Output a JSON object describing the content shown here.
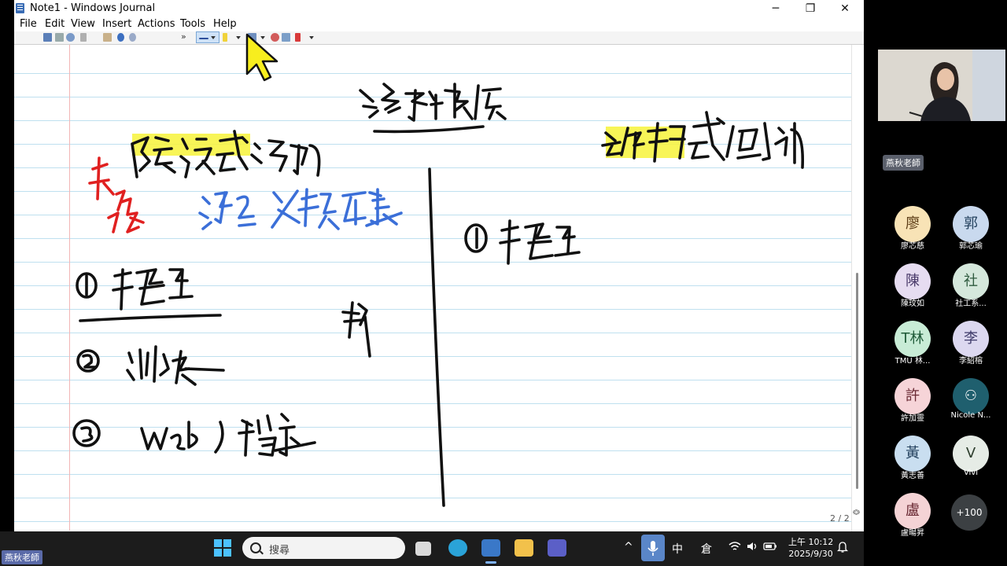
{
  "window": {
    "title": "Note1 - Windows Journal",
    "controls": {
      "minimize": "─",
      "restore": "❐",
      "close": "✕"
    }
  },
  "menu": [
    "File",
    "Edit",
    "View",
    "Insert",
    "Actions",
    "Tools",
    "Help"
  ],
  "toolbar": {
    "overflow": "»"
  },
  "page": {
    "counter": "2 / 2",
    "scroll_up": "︽",
    "scroll_down": "︾"
  },
  "meeting": {
    "presenter_chip": "燕秋老師",
    "more_count": "+100",
    "participants": [
      {
        "initial": "廖",
        "name": "廖芯慈",
        "color": "#f8e3b6"
      },
      {
        "initial": "郭",
        "name": "郭芯瑜",
        "color": "#c9d9ee"
      },
      {
        "initial": "陳",
        "name": "陳玟如",
        "color": "#e6dcf1"
      },
      {
        "initial": "社",
        "name": "社工系...",
        "color": "#d5e8dc"
      },
      {
        "initial": "T林",
        "name": "TMU 林...",
        "color": "#c8ecd6"
      },
      {
        "initial": "李",
        "name": "李紹榕",
        "color": "#dcd8f0"
      },
      {
        "initial": "許",
        "name": "許加靈",
        "color": "#f6d4d8"
      },
      {
        "initial": "⚇",
        "name": "Nicole N...",
        "color": "#1f5f6e"
      },
      {
        "initial": "黃",
        "name": "黃志善",
        "color": "#c9def0"
      },
      {
        "initial": "V",
        "name": "Vivi",
        "color": "#e6ece6"
      },
      {
        "initial": "盧",
        "name": "盧暘昇",
        "color": "#f4d3d5"
      }
    ]
  },
  "taskbar": {
    "search_placeholder": "搜尋",
    "ime": "中",
    "ime2": "倉",
    "time": "上午 10:12",
    "date": "2025/9/30",
    "tray_arrow": "^",
    "user_chip": "燕秋老師"
  },
  "colors": {
    "ink_black": "#111111",
    "ink_blue": "#3b6fd8",
    "ink_red": "#e02020",
    "highlighter": "#f7f33a",
    "rule_line": "#bfe0ef",
    "margin_line": "#f2b6b6"
  }
}
